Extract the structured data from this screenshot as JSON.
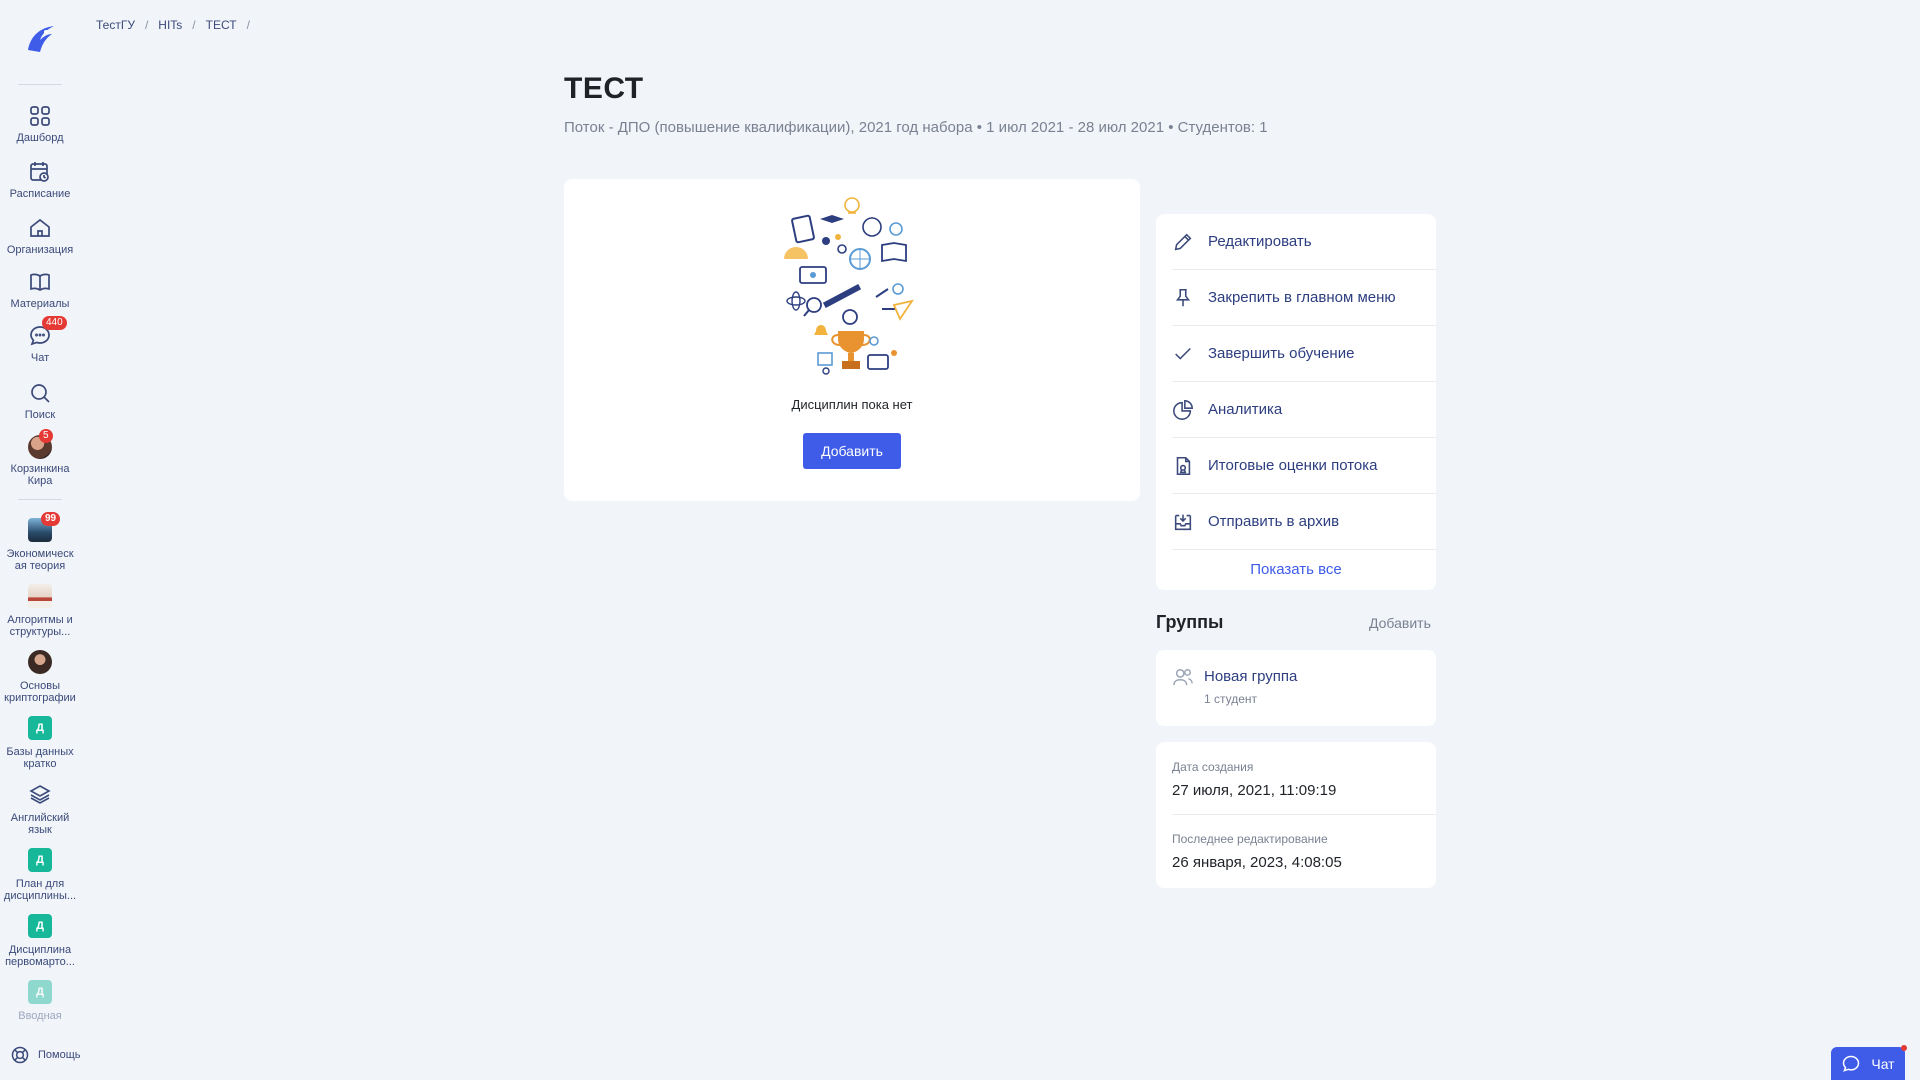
{
  "breadcrumb": [
    "ТестГУ",
    "HITs",
    "ТЕСТ"
  ],
  "page": {
    "title": "ТЕСТ",
    "subtitle": "Поток - ДПО (повышение квалификации), 2021 год набора • 1 июл 2021 - 28 июл 2021 • Студентов: 1"
  },
  "sidebar": {
    "nav": [
      {
        "label": "Дашборд",
        "icon": "grid-icon"
      },
      {
        "label": "Расписание",
        "icon": "calendar-clock-icon"
      },
      {
        "label": "Организация",
        "icon": "home-icon"
      },
      {
        "label": "Материалы",
        "icon": "book-icon"
      },
      {
        "label": "Чат",
        "icon": "chat-icon",
        "badge": "440"
      },
      {
        "label": "Поиск",
        "icon": "search-icon"
      }
    ],
    "user": {
      "name_line1": "Корзинкина",
      "name_line2": "Кира",
      "badge": "5"
    },
    "courses": [
      {
        "line1": "Экономическ",
        "line2": "ая теория",
        "badge": "99",
        "thumb": "photo"
      },
      {
        "line1": "Алгоритмы и",
        "line2": "структуры...",
        "thumb": "photo"
      },
      {
        "line1": "Основы",
        "line2": "криптографии",
        "thumb": "photo"
      },
      {
        "line1": "Базы данных",
        "line2": "кратко",
        "thumb_letter": "Д"
      },
      {
        "line1": "Английский",
        "line2": "язык",
        "thumb": "layers-icon"
      },
      {
        "line1": "План для",
        "line2": "дисциплины...",
        "thumb_letter": "Д"
      },
      {
        "line1": "Дисциплина",
        "line2": "первомарто...",
        "thumb_letter": "Д"
      },
      {
        "line1": "Вводная",
        "line2": "",
        "thumb_letter": "Д"
      }
    ],
    "help": "Помощь"
  },
  "main": {
    "empty_text": "Дисциплин пока нет",
    "add_button": "Добавить"
  },
  "actions": [
    {
      "label": "Редактировать",
      "icon": "pencil-icon"
    },
    {
      "label": "Закрепить в главном меню",
      "icon": "pin-icon"
    },
    {
      "label": "Завершить обучение",
      "icon": "check-icon"
    },
    {
      "label": "Аналитика",
      "icon": "pie-chart-icon"
    },
    {
      "label": "Итоговые оценки потока",
      "icon": "grade-document-icon"
    },
    {
      "label": "Отправить в архив",
      "icon": "archive-icon"
    }
  ],
  "show_all": "Показать все",
  "groups": {
    "title": "Группы",
    "add": "Добавить",
    "items": [
      {
        "name": "Новая группа",
        "count": "1 студент"
      }
    ]
  },
  "info": {
    "created_label": "Дата создания",
    "created_value": "27 июля, 2021, 11:09:19",
    "edited_label": "Последнее редактирование",
    "edited_value": "26 января, 2023, 4:08:05"
  },
  "chat_widget": {
    "label": "Чат"
  },
  "colors": {
    "accent": "#3e5ce8",
    "badge": "#e53935",
    "teal_thumb": "#17b89a",
    "background": "#f1f4f8"
  }
}
